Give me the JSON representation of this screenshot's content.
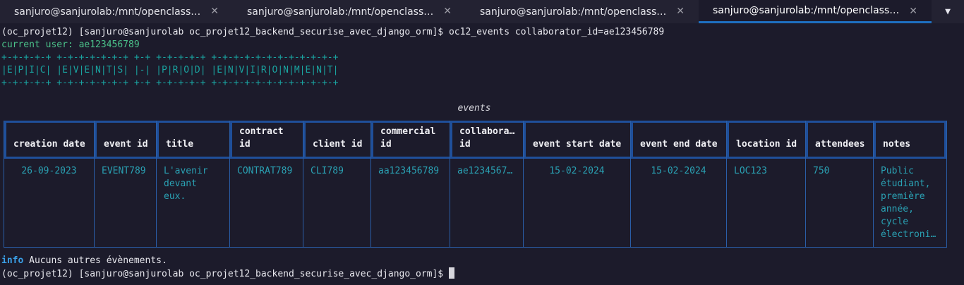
{
  "tabs": [
    {
      "label": "sanjuro@sanjurolab:/mnt/openclassro...",
      "active": false
    },
    {
      "label": "sanjuro@sanjurolab:/mnt/openclassro...",
      "active": false
    },
    {
      "label": "sanjuro@sanjurolab:/mnt/openclassro...",
      "active": false
    },
    {
      "label": "sanjuro@sanjurolab:/mnt/openclassro...",
      "active": true
    }
  ],
  "terminal": {
    "command_line": "(oc_projet12) [sanjuro@sanjurolab oc_projet12_backend_securise_avec_django_orm]$ oc12_events collaborator_id=ae123456789",
    "current_user": "current user: ae123456789",
    "banner": [
      "+-+-+-+-+ +-+-+-+-+-+-+ +-+ +-+-+-+-+ +-+-+-+-+-+-+-+-+-+-+-+",
      "|E|P|I|C| |E|V|E|N|T|S| |-| |P|R|O|D| |E|N|V|I|R|O|N|M|E|N|T|",
      "+-+-+-+-+ +-+-+-+-+-+-+ +-+ +-+-+-+-+ +-+-+-+-+-+-+-+-+-+-+-+"
    ],
    "table_title": "events",
    "table": {
      "headers": [
        "creation date",
        "event id",
        "title",
        "contract\nid",
        "client id",
        "commercial\nid",
        "collabora…\nid",
        "event start date",
        "event end date",
        "location id",
        "attendees",
        "notes"
      ],
      "row": [
        "26-09-2023",
        "EVENT789",
        "L'avenir\ndevant\neux.",
        "CONTRAT789",
        "CLI789",
        "aa123456789",
        "ae1234567…",
        "15-02-2024",
        "15-02-2024",
        "LOC123",
        "750",
        "Public\nétudiant,\npremière\nannée,\ncycle\nélectroni…"
      ]
    },
    "info_label": "info",
    "info_text": " Aucuns autres évènements.",
    "prompt": "(oc_projet12) [sanjuro@sanjurolab oc_projet12_backend_securise_avec_django_orm]$ "
  },
  "colors": {
    "background": "#1c1b2b",
    "accent": "#1e6fc0",
    "border": "#1f4f9a",
    "cell_text": "#2aa1b3",
    "green": "#4bc28a"
  }
}
